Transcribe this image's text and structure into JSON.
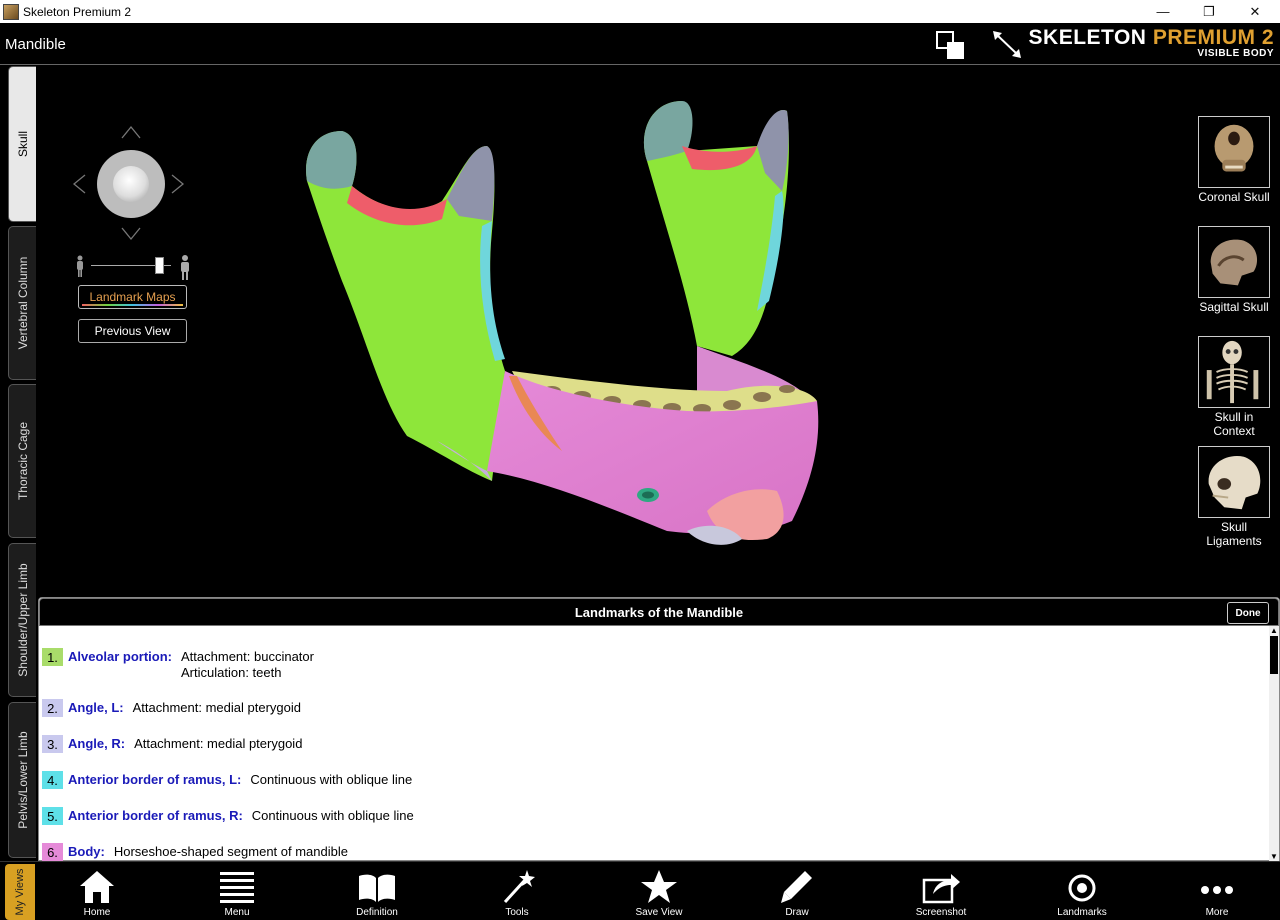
{
  "window": {
    "title": "Skeleton Premium 2",
    "controls": [
      "—",
      "❐",
      "✕"
    ]
  },
  "header": {
    "page_title": "Mandible",
    "brand_main_a": "SKELETON ",
    "brand_main_b": "PREMIUM 2",
    "brand_sub": "VISIBLE BODY"
  },
  "left_tabs": [
    "Skull",
    "Vertebral Column",
    "Thoracic Cage",
    "Shoulder/Upper Limb",
    "Pelvis/Lower Limb"
  ],
  "viewport": {
    "landmark_maps_label": "Landmark Maps",
    "previous_view_label": "Previous View",
    "zoom_level": 0.85,
    "views": [
      {
        "label": "Coronal Skull"
      },
      {
        "label": "Sagittal Skull"
      },
      {
        "label": "Skull in Context"
      },
      {
        "label": "Skull Ligaments"
      }
    ]
  },
  "panel": {
    "title": "Landmarks of the Mandible",
    "done_label": "Done",
    "items": [
      {
        "num": "1.",
        "name": "Alveolar portion:",
        "lines": [
          "Attachment: buccinator",
          "Articulation: teeth"
        ],
        "color": "#a9dc6a"
      },
      {
        "num": "2.",
        "name": "Angle, L:",
        "lines": [
          "Attachment: medial pterygoid"
        ],
        "color": "#c9c9ee"
      },
      {
        "num": "3.",
        "name": "Angle, R:",
        "lines": [
          "Attachment: medial pterygoid"
        ],
        "color": "#c9c9ee"
      },
      {
        "num": "4.",
        "name": "Anterior border of ramus, L:",
        "lines": [
          "Continuous with oblique line"
        ],
        "color": "#5ee0e8"
      },
      {
        "num": "5.",
        "name": "Anterior border of ramus, R:",
        "lines": [
          "Continuous with oblique line"
        ],
        "color": "#5ee0e8"
      },
      {
        "num": "6.",
        "name": "Body:",
        "lines": [
          "Horseshoe-shaped segment of mandible"
        ],
        "color": "#e58ad8"
      }
    ]
  },
  "toolbar": {
    "my_views_label": "My Views",
    "tools": [
      {
        "label": "Home",
        "icon": "home-icon"
      },
      {
        "label": "Menu",
        "icon": "menu-icon"
      },
      {
        "label": "Definition",
        "icon": "book-icon"
      },
      {
        "label": "Tools",
        "icon": "wand-icon"
      },
      {
        "label": "Save View",
        "icon": "star-icon"
      },
      {
        "label": "Draw",
        "icon": "pencil-icon"
      },
      {
        "label": "Screenshot",
        "icon": "share-icon"
      },
      {
        "label": "Landmarks",
        "icon": "target-icon"
      },
      {
        "label": "More",
        "icon": "more-icon"
      }
    ]
  }
}
